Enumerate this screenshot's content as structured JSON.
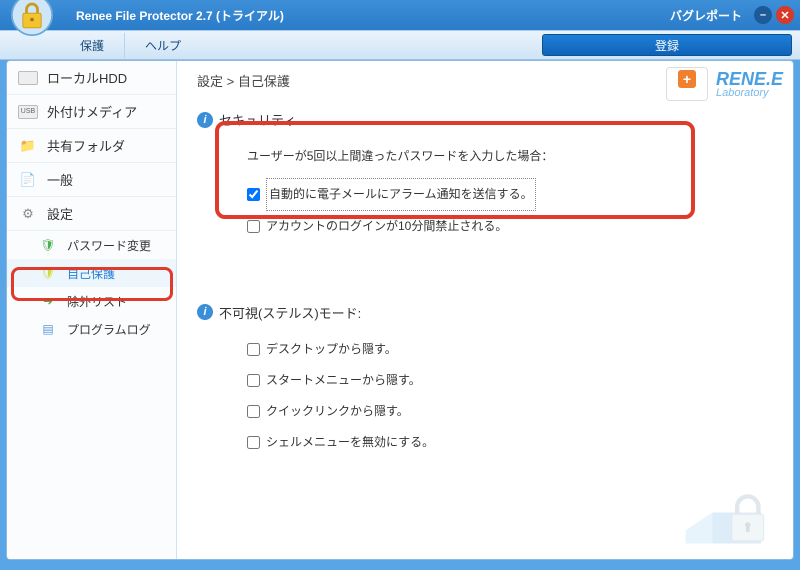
{
  "title": "Renee File Protector 2.7 (トライアル)",
  "bugreport": "バグレポート",
  "menu": {
    "protect": "保護",
    "help": "ヘルプ",
    "register": "登録"
  },
  "sidebar": {
    "items": [
      {
        "label": "ローカルHDD"
      },
      {
        "label": "外付けメディア"
      },
      {
        "label": "共有フォルダ"
      },
      {
        "label": "一般"
      },
      {
        "label": "設定"
      }
    ],
    "sub": [
      {
        "label": "パスワード変更"
      },
      {
        "label": "自己保護"
      },
      {
        "label": "除外リスト"
      },
      {
        "label": "プログラムログ"
      }
    ]
  },
  "breadcrumb": "設定 > 自己保護",
  "logo": {
    "brand": "RENE.E",
    "sub": "Laboratory"
  },
  "sections": {
    "security": {
      "title": "セキュリティ",
      "prompt": "ユーザーが5回以上間違ったパスワードを入力した場合：",
      "opt1": "自動的に電子メールにアラーム通知を送信する。",
      "opt2": "アカウントのログインが10分間禁止される。"
    },
    "stealth": {
      "title": "不可視(ステルス)モード:",
      "opt1": "デスクトップから隠す。",
      "opt2": "スタートメニューから隠す。",
      "opt3": "クイックリンクから隠す。",
      "opt4": "シェルメニューを無効にする。"
    }
  }
}
